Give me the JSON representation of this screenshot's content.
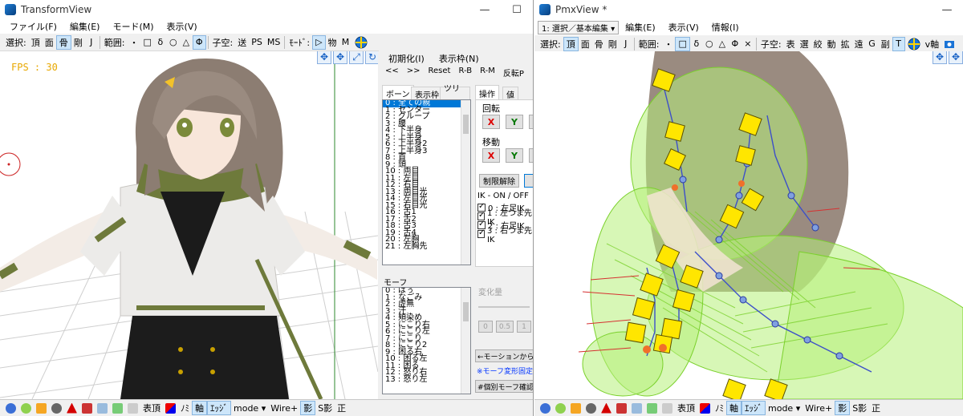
{
  "transform_view": {
    "title": "TransformView",
    "menu": [
      "ファイル(F)",
      "編集(E)",
      "モード(M)",
      "表示(V)"
    ],
    "toolbar": {
      "select_label": "選択:",
      "select_items": [
        "頂",
        "面",
        "骨",
        "剛",
        "J"
      ],
      "range_label": "範囲:",
      "range_items": [
        "・",
        "□",
        "δ",
        "○",
        "△",
        "Φ"
      ],
      "child_label": "子空:",
      "child_items": [
        "送",
        "PS",
        "MS"
      ],
      "mode_label": "ﾓｰﾄﾞ:",
      "mode_items": [
        "▷",
        "物",
        "M"
      ]
    },
    "fps": "FPS : 30",
    "panel_menu": [
      "初期化(I)",
      "表示枠(N)"
    ],
    "panel_nav": [
      "<<",
      ">>",
      "Reset",
      "R-B",
      "R-M",
      "反転P"
    ],
    "bone_tabs": [
      "ボーン",
      "表示枠",
      "ツリー"
    ],
    "bones": [
      "0 : 全ての親",
      "1 : センター",
      "2 : グループ",
      "3 : 腰",
      "4 : 下半身",
      "5 : 上半身",
      "6 : 上半身2",
      "7 : 上半身3",
      "8 : 首",
      "9 : 頭",
      "10 : 両目",
      "11 : 左目",
      "12 : 右目",
      "13 : 両目光",
      "14 : 左目光",
      "15 : 右目光",
      "16 : 舌1",
      "17 : 舌2",
      "18 : 舌3",
      "19 : 舌4",
      "20 : 左胸",
      "21 : 左胸先"
    ],
    "op_tabs": [
      "操作",
      "値"
    ],
    "rotate_label": "回転",
    "move_label": "移動",
    "axis_x": "X",
    "axis_y": "Y",
    "limit_release": "制限解除",
    "ik_label": "IK - ON / OFF",
    "ik_items": [
      "0 : 左足IK",
      "1 : 左つま先IK",
      "2 : 右足IK",
      "3 : 右つま先IK"
    ],
    "morph_label": "モーフ",
    "morphs": [
      "0 : ぱぅ",
      "1 : なごみ",
      "2 : 虚無",
      "3 : 汗",
      "4 : 頬染め",
      "5 : にこり右",
      "6 : にこり左",
      "7 : にこり",
      "8 : にこり2",
      "9 : 困る右",
      "10 : 困る左",
      "11 : 困る",
      "12 : 怒り右",
      "13 : 怒り左"
    ],
    "change_label": "変化量",
    "change_values": [
      "0",
      "0.5",
      "1"
    ],
    "from_motion": "←モーションから取",
    "morph_note": "※モーフ変形固定",
    "morph_confirm": "#個別モーフ確認",
    "bottom": {
      "mode": "mode ▾",
      "wire": "Wire+",
      "labels": [
        "表頂",
        "ﾉﾐ",
        "軸",
        "ｴｯｼﾞ",
        "影",
        "S影",
        "正"
      ]
    }
  },
  "pmx_view": {
    "title": "PmxView *",
    "mode_select": "1: 選択／基本編集",
    "menu": [
      "編集(E)",
      "表示(V)",
      "情報(I)"
    ],
    "toolbar": {
      "select_label": "選択:",
      "select_items": [
        "頂",
        "面",
        "骨",
        "剛",
        "J"
      ],
      "range_label": "範囲:",
      "range_items": [
        "・",
        "□",
        "δ",
        "○",
        "△",
        "Φ",
        "×"
      ],
      "child_label": "子空:",
      "child_items": [
        "表",
        "選",
        "絞",
        "動",
        "拡",
        "遠",
        "G",
        "副",
        "T"
      ],
      "vaxis": "v軸"
    },
    "bottom": {
      "mode": "mode ▾",
      "wire": "Wire+",
      "labels": [
        "表頂",
        "ﾉﾐ",
        "軸",
        "ｴｯｼﾞ",
        "影",
        "S影",
        "正"
      ]
    }
  },
  "window_buttons": [
    "—",
    "☐"
  ],
  "colors": {
    "accent": "#0078d7",
    "bone": "#ffe600",
    "rigid": "#88ff44"
  }
}
